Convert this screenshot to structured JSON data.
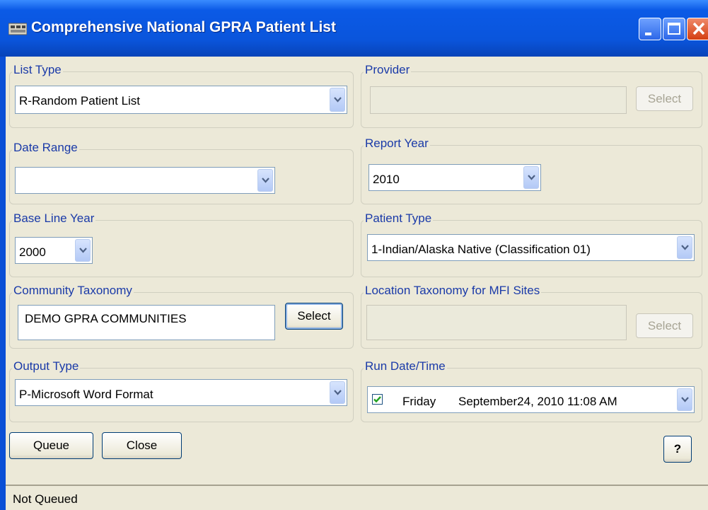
{
  "window": {
    "title": "Comprehensive National GPRA Patient List"
  },
  "groups": {
    "list_type": {
      "label": "List Type",
      "value": "R-Random Patient List"
    },
    "provider": {
      "label": "Provider",
      "value": "",
      "select_label": "Select"
    },
    "date_range": {
      "label": "Date Range",
      "value": ""
    },
    "report_year": {
      "label": "Report Year",
      "value": "2010"
    },
    "base_line_year": {
      "label": "Base Line Year",
      "value": "2000"
    },
    "patient_type": {
      "label": "Patient Type",
      "value": "1-Indian/Alaska Native (Classification 01)"
    },
    "community_taxonomy": {
      "label": "Community Taxonomy",
      "value": "DEMO GPRA COMMUNITIES",
      "select_label": "Select"
    },
    "location_taxonomy": {
      "label": "Location Taxonomy for MFI Sites",
      "value": "",
      "select_label": "Select"
    },
    "output_type": {
      "label": "Output Type",
      "value": "P-Microsoft Word Format"
    },
    "run_datetime": {
      "label": "Run Date/Time",
      "checked": true,
      "day": "Friday",
      "datetime": "September24, 2010  11:08 AM"
    }
  },
  "buttons": {
    "queue": "Queue",
    "close": "Close",
    "help": "?"
  },
  "status_bar": {
    "text": "Not Queued"
  },
  "colors": {
    "titlebar": "#0a55dc",
    "legend": "#1a3aa8",
    "face": "#ece9d8"
  }
}
